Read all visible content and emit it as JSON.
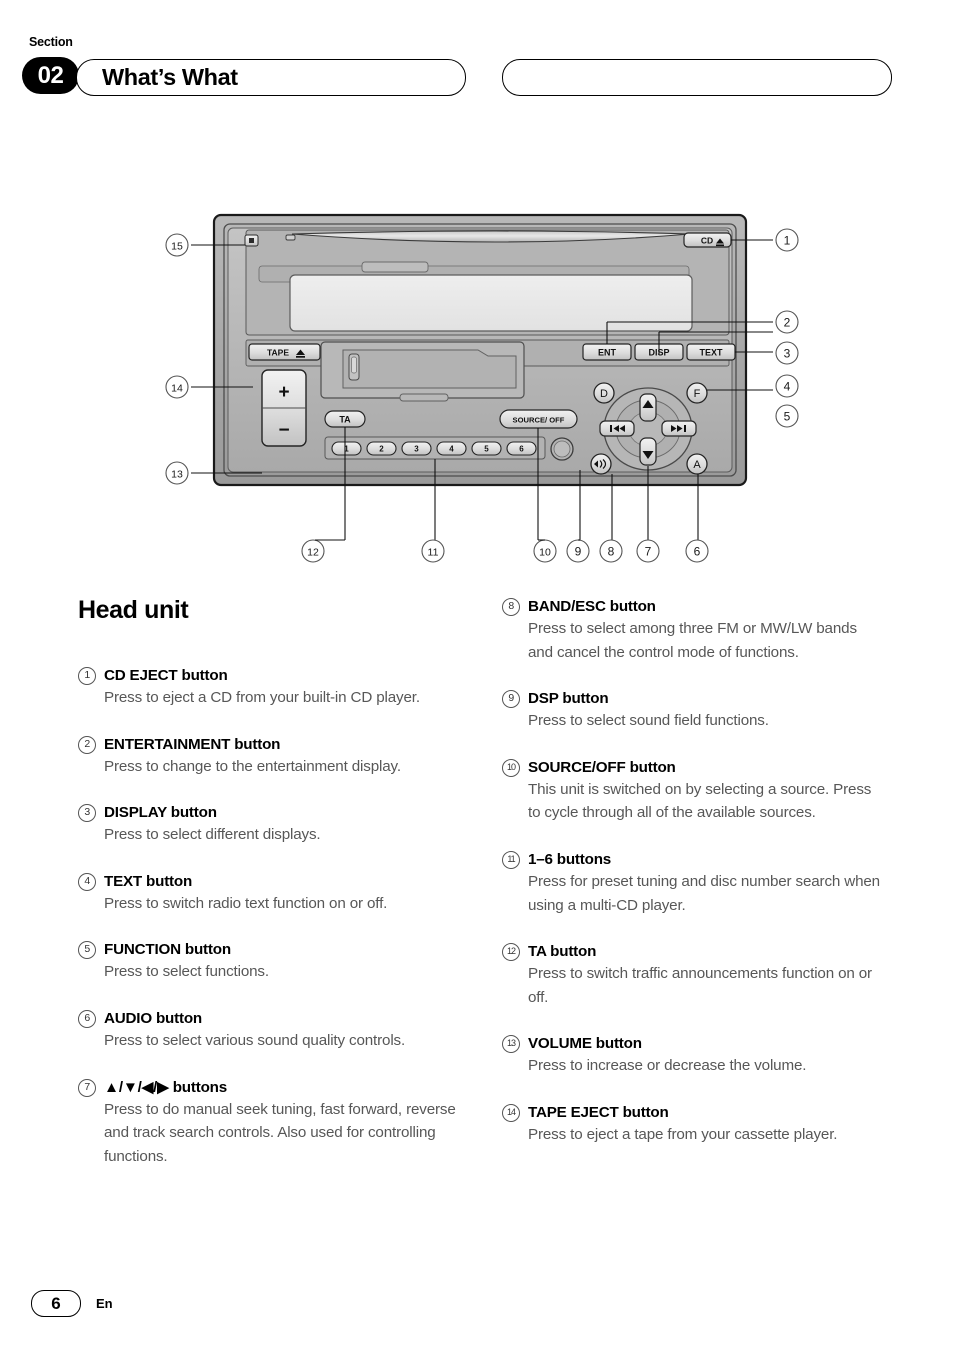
{
  "header": {
    "section_label": "Section",
    "section_number": "02",
    "title": "What’s What",
    "right_box_text": ""
  },
  "content": {
    "heading": "Head unit"
  },
  "device": {
    "labels": {
      "cd_eject": "CD⏏",
      "tape_eject": "TAPE ⏏",
      "ent": "ENT",
      "disp": "DISP",
      "text": "TEXT",
      "source_off": "SOURCE/ OFF",
      "ta": "TA",
      "d": "D",
      "f": "F",
      "a": "A",
      "vol_up": "+",
      "vol_down": "−",
      "rev": "◀◀",
      "fwd": "▶▶",
      "up": "▲",
      "down": "▼",
      "band": "◀»"
    },
    "preset_buttons": [
      "1",
      "2",
      "3",
      "4",
      "5",
      "6"
    ],
    "callouts_right": [
      "1",
      "2",
      "3",
      "4",
      "5"
    ],
    "callouts_left": [
      "15",
      "14",
      "13"
    ],
    "callouts_bottom": [
      "12",
      "11",
      "10",
      "9",
      "8",
      "7",
      "6"
    ]
  },
  "left_column": [
    {
      "num": "1",
      "title": "CD EJECT button",
      "desc": "Press to eject a CD from your built-in CD player."
    },
    {
      "num": "2",
      "title": "ENTERTAINMENT button",
      "desc": "Press to change to the entertainment display."
    },
    {
      "num": "3",
      "title": "DISPLAY button",
      "desc": "Press to select different displays."
    },
    {
      "num": "4",
      "title": "TEXT button",
      "desc": "Press to switch radio text function on or off."
    },
    {
      "num": "5",
      "title": "FUNCTION button",
      "desc": "Press to select functions."
    },
    {
      "num": "6",
      "title": "AUDIO button",
      "desc": "Press to select various sound quality controls."
    },
    {
      "num": "7",
      "title": "▲/▼/◀/▶ buttons",
      "desc": "Press to do manual seek tuning, fast forward, reverse and track search controls. Also used for controlling functions."
    }
  ],
  "right_column": [
    {
      "num": "8",
      "title": "BAND/ESC button",
      "desc": "Press to select among three FM or MW/LW bands and cancel the control mode of functions."
    },
    {
      "num": "9",
      "title": "DSP button",
      "desc": "Press to select sound field functions."
    },
    {
      "num": "10",
      "title": "SOURCE/OFF button",
      "desc": "This unit is switched on by selecting a source. Press to cycle through all of the available sources."
    },
    {
      "num": "11",
      "title": "1–6 buttons",
      "desc": "Press for preset tuning and disc number search when using a multi-CD player."
    },
    {
      "num": "12",
      "title": "TA button",
      "desc": "Press to switch traffic announcements function on or off."
    },
    {
      "num": "13",
      "title": "VOLUME button",
      "desc": "Press to increase or decrease the volume."
    },
    {
      "num": "14",
      "title": "TAPE EJECT button",
      "desc": "Press to eject a tape from your cassette player."
    }
  ],
  "footer": {
    "page_number": "6",
    "language": "En"
  }
}
